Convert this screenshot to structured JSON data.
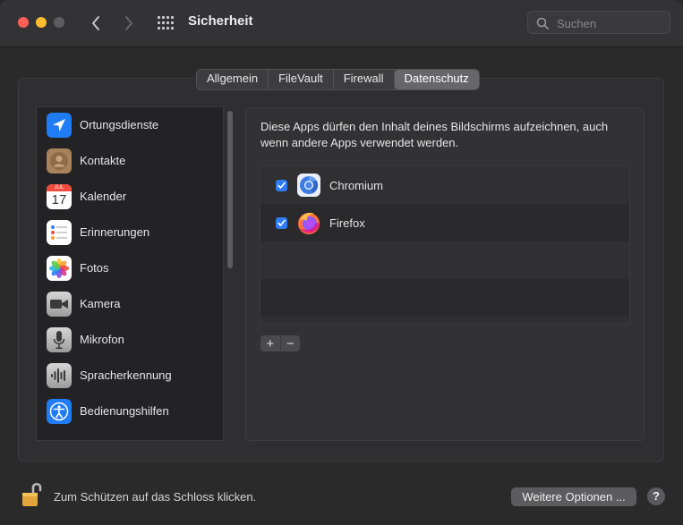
{
  "window": {
    "title": "Sicherheit"
  },
  "search": {
    "placeholder": "Suchen",
    "value": ""
  },
  "tabs": [
    {
      "label": "Allgemein",
      "active": false
    },
    {
      "label": "FileVault",
      "active": false
    },
    {
      "label": "Firewall",
      "active": false
    },
    {
      "label": "Datenschutz",
      "active": true
    }
  ],
  "sidebar": {
    "items": [
      {
        "label": "Ortungsdienste",
        "icon": "location-icon",
        "color": "#1f7cf5"
      },
      {
        "label": "Kontakte",
        "icon": "contacts-icon",
        "color": "#a8825a"
      },
      {
        "label": "Kalender",
        "icon": "calendar-icon",
        "color": "#ffffff",
        "month": "JUL",
        "day": "17"
      },
      {
        "label": "Erinnerungen",
        "icon": "reminders-icon",
        "color": "#ffffff"
      },
      {
        "label": "Fotos",
        "icon": "photos-icon",
        "color": "#ffffff"
      },
      {
        "label": "Kamera",
        "icon": "camera-icon",
        "color": "#b0b0b0"
      },
      {
        "label": "Mikrofon",
        "icon": "microphone-icon",
        "color": "#b0b0b0"
      },
      {
        "label": "Spracherkennung",
        "icon": "speech-recognition-icon",
        "color": "#b0b0b0"
      },
      {
        "label": "Bedienungshilfen",
        "icon": "accessibility-icon",
        "color": "#1f7cf5"
      }
    ]
  },
  "main": {
    "description": "Diese Apps dürfen den Inhalt deines Bildschirms aufzeichnen, auch wenn andere Apps verwendet werden.",
    "apps": [
      {
        "name": "Chromium",
        "checked": true,
        "icon": "chromium-icon"
      },
      {
        "name": "Firefox",
        "checked": true,
        "icon": "firefox-icon"
      }
    ],
    "add_label": "+",
    "remove_label": "−"
  },
  "footer": {
    "lock_message": "Zum Schützen auf das Schloss klicken.",
    "more_button": "Weitere Optionen ...",
    "help_button": "?"
  }
}
